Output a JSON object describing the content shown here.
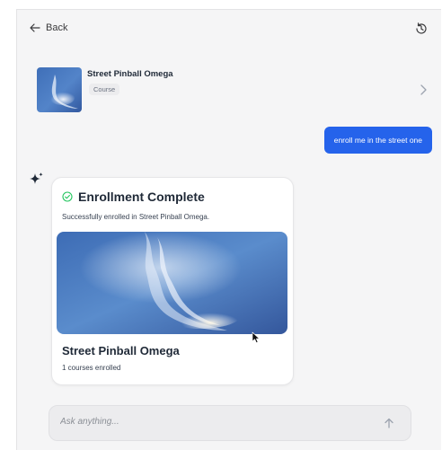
{
  "header": {
    "back_label": "Back",
    "back_icon": "arrow-left-icon",
    "history_icon": "history-icon"
  },
  "course_preview": {
    "title": "Street Pinball Omega",
    "tag": "Course",
    "chevron_icon": "chevron-right-icon"
  },
  "messages": {
    "user": "enroll me in the street one"
  },
  "assistant": {
    "icon": "sparkle-icon",
    "card": {
      "status_icon": "check-circle-icon",
      "title": "Enrollment Complete",
      "description": "Successfully enrolled in Street Pinball Omega.",
      "course_name": "Street Pinball Omega",
      "enrolled_count": "1 courses enrolled"
    }
  },
  "composer": {
    "placeholder": "Ask anything...",
    "value": "",
    "send_icon": "arrow-up-icon"
  },
  "colors": {
    "accent": "#2563eb",
    "success": "#22c55e",
    "background": "#f5f5f6"
  }
}
